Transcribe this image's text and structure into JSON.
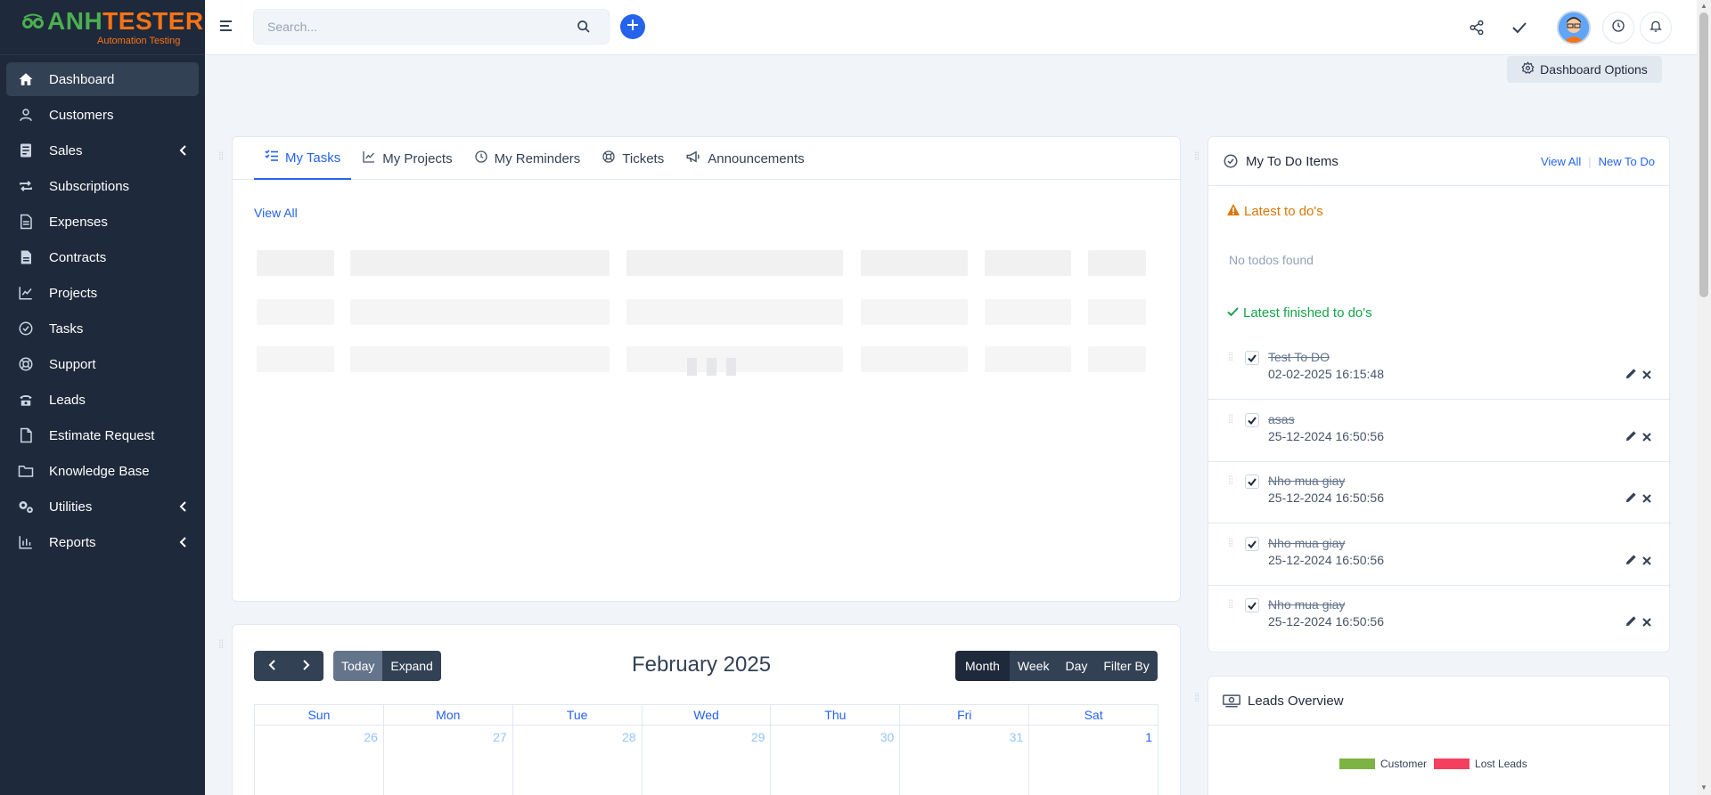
{
  "brand": {
    "name_part1": "ANH",
    "name_part2": "TESTER",
    "tagline": "Automation Testing"
  },
  "sidebar": {
    "items": [
      {
        "label": "Dashboard",
        "icon": "home-icon"
      },
      {
        "label": "Customers",
        "icon": "user-icon"
      },
      {
        "label": "Sales",
        "icon": "receipt-icon"
      },
      {
        "label": "Subscriptions",
        "icon": "repeat-icon"
      },
      {
        "label": "Expenses",
        "icon": "file-text-icon"
      },
      {
        "label": "Contracts",
        "icon": "contract-icon"
      },
      {
        "label": "Projects",
        "icon": "chart-icon"
      },
      {
        "label": "Tasks",
        "icon": "check-circle-icon"
      },
      {
        "label": "Support",
        "icon": "lifebuoy-icon"
      },
      {
        "label": "Leads",
        "icon": "phone-icon"
      },
      {
        "label": "Estimate Request",
        "icon": "file-icon"
      },
      {
        "label": "Knowledge Base",
        "icon": "folder-icon"
      },
      {
        "label": "Utilities",
        "icon": "cogs-icon"
      },
      {
        "label": "Reports",
        "icon": "bar-chart-icon"
      }
    ]
  },
  "search": {
    "placeholder": "Search..."
  },
  "dashboard_options": "Dashboard Options",
  "tasks_panel": {
    "tabs": [
      "My Tasks",
      "My Projects",
      "My Reminders",
      "Tickets",
      "Announcements"
    ],
    "view_all": "View All"
  },
  "todo": {
    "title": "My To Do Items",
    "view_all": "View All",
    "new_todo": "New To Do",
    "latest_heading": "Latest to do's",
    "empty_text": "No todos found",
    "finished_heading": "Latest finished to do's",
    "items": [
      {
        "title": "Test To DO",
        "date": "02-02-2025 16:15:48"
      },
      {
        "title": "asas",
        "date": "25-12-2024 16:50:56"
      },
      {
        "title": "Nho mua giay",
        "date": "25-12-2024 16:50:56"
      },
      {
        "title": "Nho mua giay",
        "date": "25-12-2024 16:50:56"
      },
      {
        "title": "Nho mua giay",
        "date": "25-12-2024 16:50:56"
      }
    ]
  },
  "calendar": {
    "title": "February 2025",
    "today": "Today",
    "expand": "Expand",
    "views": [
      "Month",
      "Week",
      "Day",
      "Filter By"
    ],
    "weekdays": [
      "Sun",
      "Mon",
      "Tue",
      "Wed",
      "Thu",
      "Fri",
      "Sat"
    ],
    "first_row": [
      "26",
      "27",
      "28",
      "29",
      "30",
      "31",
      "1"
    ]
  },
  "leads": {
    "title": "Leads Overview",
    "legend": [
      {
        "label": "Customer",
        "color": "#7cb342"
      },
      {
        "label": "Lost Leads",
        "color": "#f43f5e"
      }
    ]
  },
  "colors": {
    "primary": "#2563eb",
    "sidebar": "#1e293b",
    "warning": "#d97706",
    "success": "#16a34a"
  }
}
